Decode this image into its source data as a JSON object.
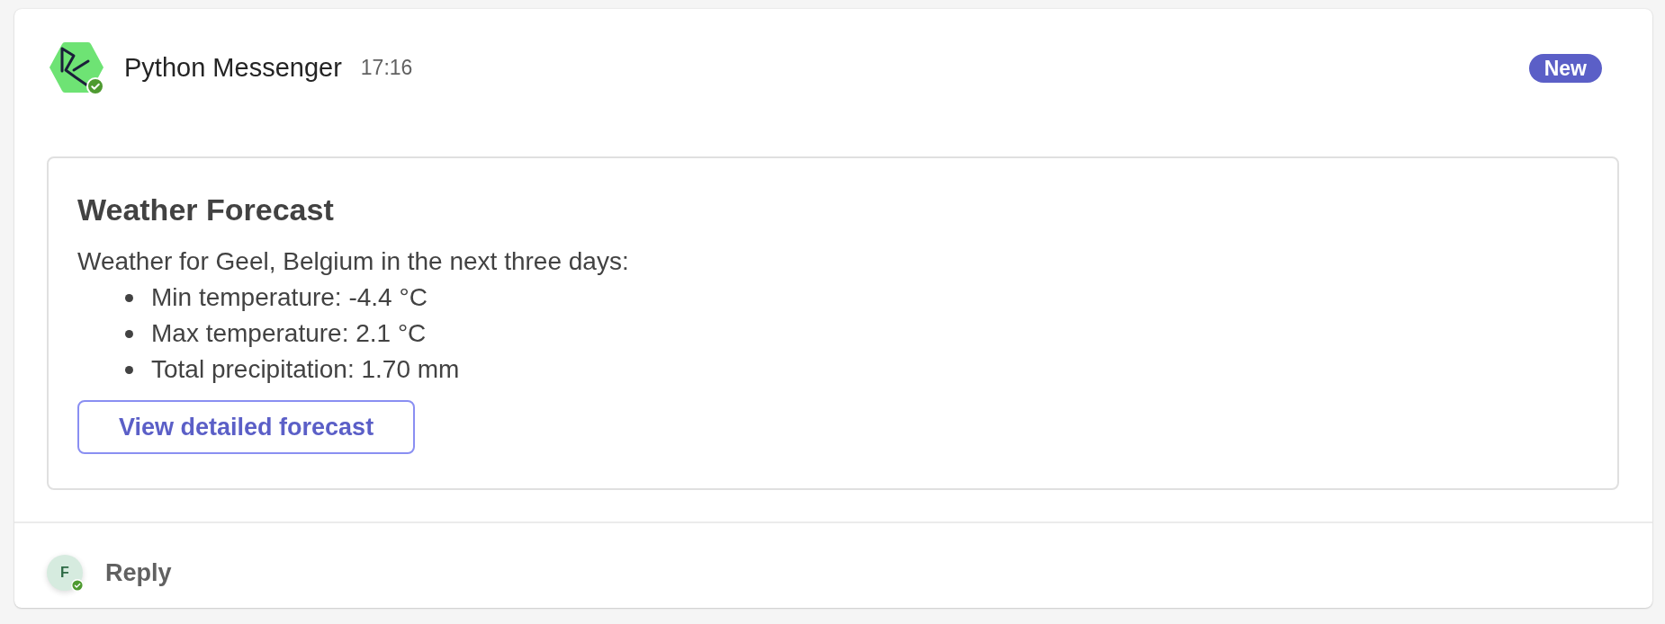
{
  "message": {
    "sender": {
      "name": "Python Messenger",
      "available": true
    },
    "time": "17:16",
    "badge": "New"
  },
  "card": {
    "title": "Weather Forecast",
    "intro": "Weather for Geel, Belgium in the next three days:",
    "items": [
      "Min temperature: -4.4 °C",
      "Max temperature: 2.1 °C",
      "Total precipitation: 1.70 mm"
    ],
    "action": "View detailed forecast"
  },
  "reply": {
    "avatar_initial": "F",
    "available": true,
    "label": "Reply"
  }
}
